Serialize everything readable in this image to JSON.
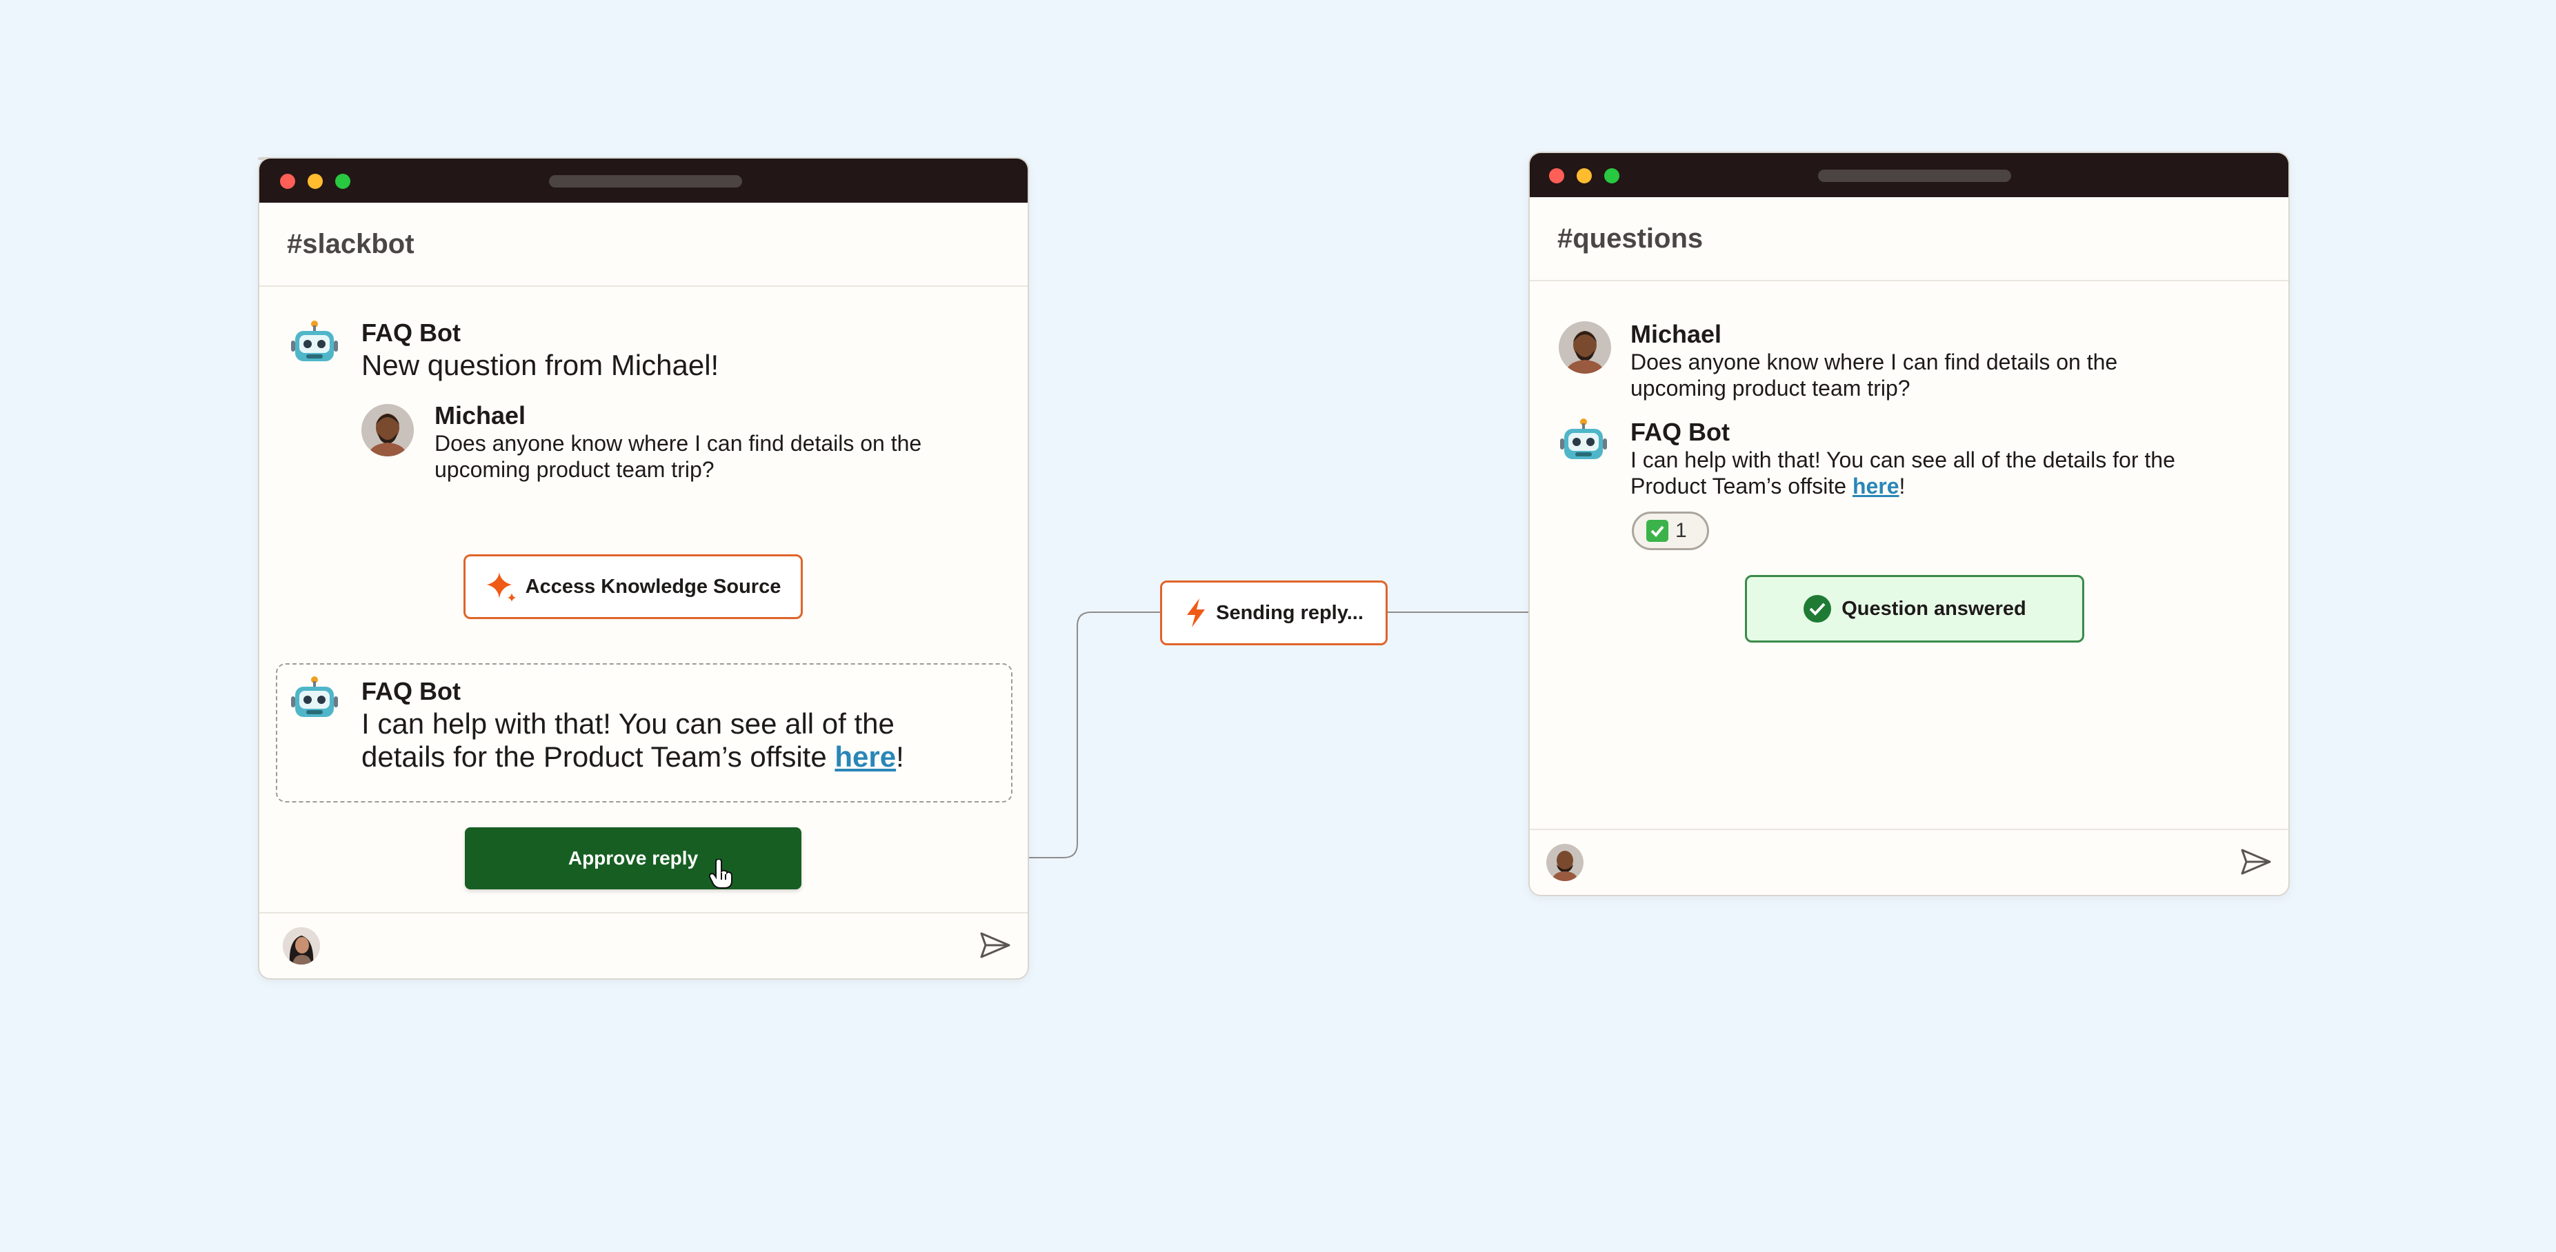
{
  "left_window": {
    "channel": "#slackbot",
    "messages": [
      {
        "sender": "FAQ Bot",
        "text": "New question from Michael!"
      },
      {
        "sender": "Michael",
        "text_line1": "Does anyone know where I can find details on the",
        "text_line2": "upcoming product team trip?"
      }
    ],
    "node_knowledge": "Access Knowledge Source",
    "draft_reply": {
      "sender": "FAQ Bot",
      "text_line1": "I can help with that! You can see all of the",
      "text_line2_pre": "details for the Product Team’s offsite ",
      "link": "here",
      "text_line2_post": "!"
    },
    "approve_button": "Approve reply"
  },
  "middle_node": "Sending reply...",
  "right_window": {
    "channel": "#questions",
    "messages": [
      {
        "sender": "Michael",
        "text_line1": "Does anyone know where I can find details on the",
        "text_line2": "upcoming product team trip?"
      },
      {
        "sender": "FAQ Bot",
        "text_line1": "I can help with that! You can see all of the details for the",
        "text_line2_pre": "Product Team’s offsite ",
        "link": "here",
        "text_line2_post": "!"
      }
    ],
    "reaction_count": "1"
  },
  "status_node": "Question answered",
  "colors": {
    "background": "#eef6fd",
    "titlebar": "#221616",
    "accent_orange": "#e0642a",
    "approve_green": "#175e23",
    "answered_green": "#3a8a4a",
    "link_blue": "#2a86b8"
  },
  "icons": [
    "robot-icon",
    "sparkle-icon",
    "lightning-icon",
    "check-circle-icon",
    "checkmark-emoji-icon",
    "send-icon",
    "cursor-hand-icon"
  ]
}
